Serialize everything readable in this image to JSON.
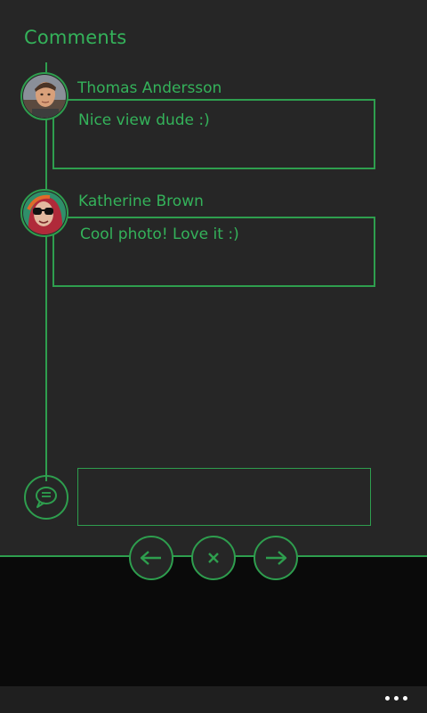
{
  "page": {
    "title": "Comments"
  },
  "comments": [
    {
      "author": "Thomas Andersson",
      "text": "Nice view dude :)",
      "avatar_icon": "user-photo-icon"
    },
    {
      "author": "Katherine Brown",
      "text": "Cool photo! Love it :)",
      "avatar_icon": "user-photo-icon"
    }
  ],
  "compose": {
    "icon": "chat-bubble-icon",
    "value": "",
    "placeholder": ""
  },
  "navigation": {
    "back_icon": "arrow-left-icon",
    "close_icon": "close-icon",
    "forward_icon": "arrow-right-icon"
  },
  "appbar": {
    "more_icon": "ellipsis-icon"
  },
  "colors": {
    "accent": "#2e9e4e",
    "text_accent": "#34b25a",
    "background": "#262626",
    "bottom_background": "#0a0a0a"
  }
}
